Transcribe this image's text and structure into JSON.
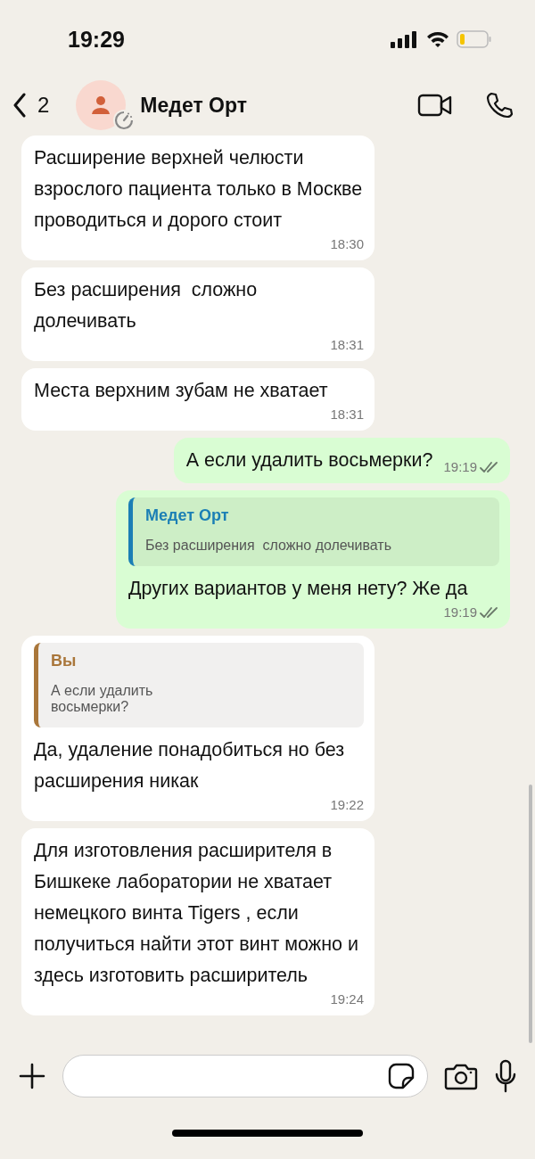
{
  "status_bar": {
    "time": "19:29"
  },
  "header": {
    "unread_count": "2",
    "contact_name": "Медет Орт"
  },
  "messages": [
    {
      "kind": "incoming",
      "text": "Расширение верхней челюсти взрослого пациента только в Москве проводиться и дорого стоит",
      "time": "18:30"
    },
    {
      "kind": "incoming",
      "text": "Без расширения  сложно долечивать",
      "time": "18:31"
    },
    {
      "kind": "incoming",
      "text": "Места верхним зубам не хватает",
      "time": "18:31"
    },
    {
      "kind": "outgoing",
      "text": "А если удалить восьмерки?",
      "time": "19:19",
      "ticks": true
    },
    {
      "kind": "outgoing",
      "reply": {
        "author": "Медет Орт",
        "text": "Без расширения  сложно долечивать",
        "color": "#1b7fb5"
      },
      "text": "Других вариантов у меня нету? Же да",
      "time": "19:19",
      "ticks": true
    },
    {
      "kind": "incoming",
      "reply": {
        "author": "Вы",
        "text": "А если удалить восьмерки?",
        "color": "#a9763a"
      },
      "text": "Да, удаление понадобиться но без расширения никак",
      "time": "19:22"
    },
    {
      "kind": "incoming",
      "text": "Для изготовления расширителя в Бишкеке лаборатории не хватает немецкого винта Tigers , если получиться найти этот винт можно и здесь изготовить расширитель",
      "time": "19:24"
    }
  ]
}
